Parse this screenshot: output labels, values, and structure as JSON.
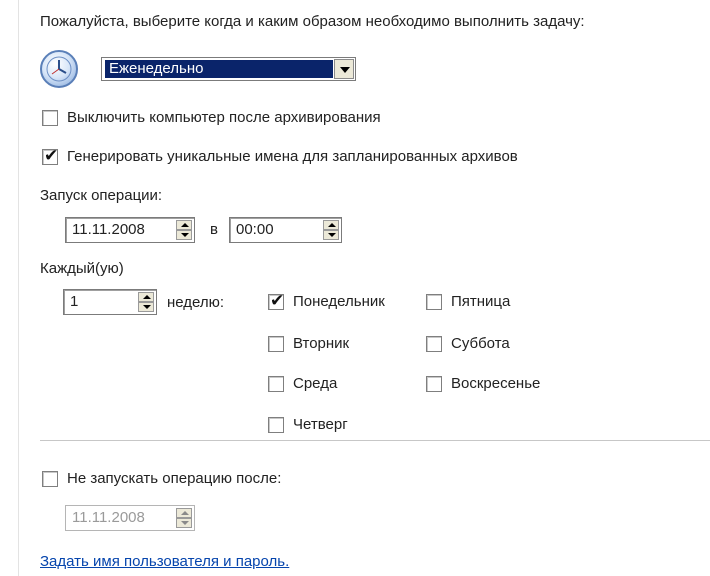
{
  "prompt": "Пожалуйста, выберите когда и каким образом необходимо выполнить задачу:",
  "schedule": {
    "selected": "Еженедельно"
  },
  "shutdown": {
    "label": "Выключить компьютер после архивирования",
    "checked": false
  },
  "unique_names": {
    "label": "Генерировать уникальные имена для запланированных архивов",
    "checked": true
  },
  "start": {
    "label": "Запуск операции:",
    "date": "11.11.2008",
    "at": "в",
    "time": "00:00"
  },
  "every": {
    "label": "Каждый(ую)",
    "value": "1",
    "unit": "неделю:"
  },
  "days": {
    "monday": {
      "label": "Понедельник",
      "checked": true
    },
    "tuesday": {
      "label": "Вторник",
      "checked": false
    },
    "wednesday": {
      "label": "Среда",
      "checked": false
    },
    "thursday": {
      "label": "Четверг",
      "checked": false
    },
    "friday": {
      "label": "Пятница",
      "checked": false
    },
    "saturday": {
      "label": "Суббота",
      "checked": false
    },
    "sunday": {
      "label": "Воскресенье",
      "checked": false
    }
  },
  "no_start_after": {
    "label": "Не запускать операцию после:",
    "checked": false,
    "date": "11.11.2008"
  },
  "credentials_link": "Задать имя пользователя и пароль.",
  "icons": {
    "clock": "clock-icon",
    "check": "checkmark-icon",
    "dropdown": "chevron-down-icon",
    "spin_up": "spin-up-icon",
    "spin_down": "spin-down-icon"
  }
}
